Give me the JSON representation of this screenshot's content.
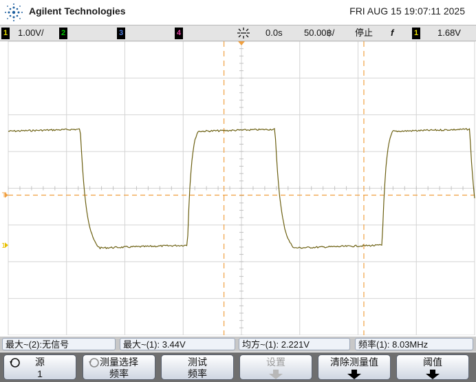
{
  "header": {
    "brand": "Agilent Technologies",
    "datetime": "FRI AUG 15 19:07:11 2025"
  },
  "status": {
    "ch1_num": "1",
    "ch1_scale": "1.00V/",
    "ch2_num": "2",
    "ch3_num": "3",
    "ch4_num": "4",
    "time_offset": "0.0s",
    "time_scale": "50.00฿/",
    "run_state": "停止",
    "trigger_edge": "f",
    "trigger_source": "1",
    "trigger_level": "1.68V",
    "colors": {
      "ch1": "#e8e000",
      "ch2": "#00c800",
      "ch3": "#4f7fe0",
      "ch4": "#e040a0"
    }
  },
  "scope": {
    "trace_color": "#6b5f10",
    "cursor_color": "#f0a040",
    "trigger_marker": "T",
    "ground_marker": "1",
    "cycle_divisions": 3.34,
    "high_level_div": 1.7,
    "low_level_div": -1.7
  },
  "measurements": [
    {
      "label": "最大~(2):无信号"
    },
    {
      "label": "最大~(1): 3.44V"
    },
    {
      "label": "均方~(1): 2.221V"
    },
    {
      "label": "频率(1): 8.03MHz"
    }
  ],
  "softkeys": [
    {
      "line1": "源",
      "line2": "1",
      "icon": "rotate-knob-icon",
      "enabled": true
    },
    {
      "line1": "测量选择",
      "line2": "频率",
      "icon": "rotate-knob-icon",
      "enabled": true
    },
    {
      "line1": "测试",
      "line2": "频率",
      "enabled": true
    },
    {
      "line1": "设置",
      "enabled": false
    },
    {
      "line1": "清除测量值",
      "enabled": true
    },
    {
      "line1": "阈值",
      "enabled": true
    }
  ]
}
